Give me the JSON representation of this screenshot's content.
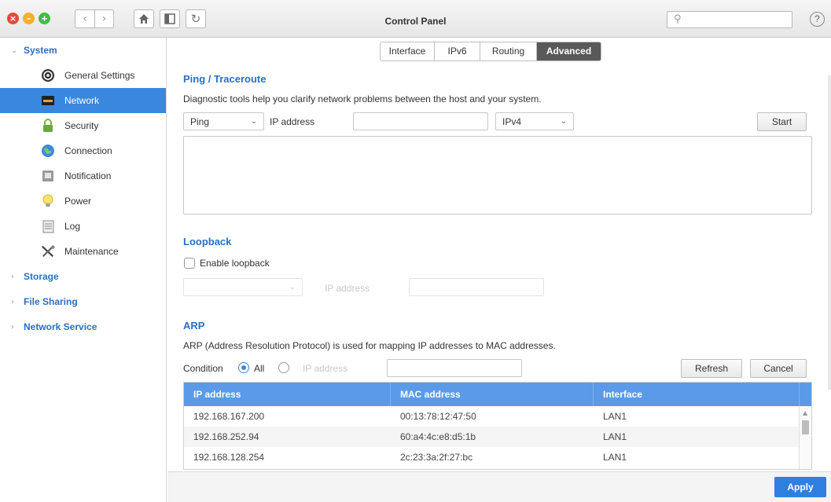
{
  "window": {
    "title": "Control Panel",
    "search_placeholder": "",
    "help_label": "?"
  },
  "sidebar": {
    "groups": [
      {
        "label": "System",
        "expanded": true
      },
      {
        "label": "Storage",
        "expanded": false
      },
      {
        "label": "File Sharing",
        "expanded": false
      },
      {
        "label": "Network Service",
        "expanded": false
      }
    ],
    "system_items": [
      {
        "label": "General Settings",
        "icon": "gear-icon"
      },
      {
        "label": "Network",
        "icon": "network-icon",
        "active": true
      },
      {
        "label": "Security",
        "icon": "lock-icon"
      },
      {
        "label": "Connection",
        "icon": "globe-icon"
      },
      {
        "label": "Notification",
        "icon": "notification-icon"
      },
      {
        "label": "Power",
        "icon": "lightbulb-icon"
      },
      {
        "label": "Log",
        "icon": "log-icon"
      },
      {
        "label": "Maintenance",
        "icon": "tools-icon"
      }
    ]
  },
  "tabs": [
    {
      "label": "Interface"
    },
    {
      "label": "IPv6"
    },
    {
      "label": "Routing"
    },
    {
      "label": "Advanced",
      "active": true
    }
  ],
  "ping": {
    "title": "Ping / Traceroute",
    "description": "Diagnostic tools help you clarify network problems between the host and your system.",
    "tool_value": "Ping",
    "ip_label": "IP address",
    "ip_value": "",
    "protocol_value": "IPv4",
    "start_label": "Start"
  },
  "loopback": {
    "title": "Loopback",
    "enable_label": "Enable loopback",
    "enabled": false,
    "ip_label": "IP address"
  },
  "arp": {
    "title": "ARP",
    "description": "ARP (Address Resolution Protocol) is used for mapping IP addresses to MAC addresses.",
    "condition_label": "Condition",
    "option_all": "All",
    "option_ip": "IP address",
    "refresh_label": "Refresh",
    "cancel_label": "Cancel",
    "columns": [
      "IP address",
      "MAC address",
      "Interface"
    ],
    "rows": [
      [
        "192.168.167.200",
        "00:13:78:12:47:50",
        "LAN1"
      ],
      [
        "192.168.252.94",
        "60:a4:4c:e8:d5:1b",
        "LAN1"
      ],
      [
        "192.168.128.254",
        "2c:23:3a:2f:27:bc",
        "LAN1"
      ]
    ]
  },
  "footer": {
    "apply_label": "Apply"
  },
  "colors": {
    "accent": "#3a87e0",
    "section_title": "#2a6fc2",
    "table_header": "#5a9ae8",
    "apply": "#2d7fe0"
  }
}
